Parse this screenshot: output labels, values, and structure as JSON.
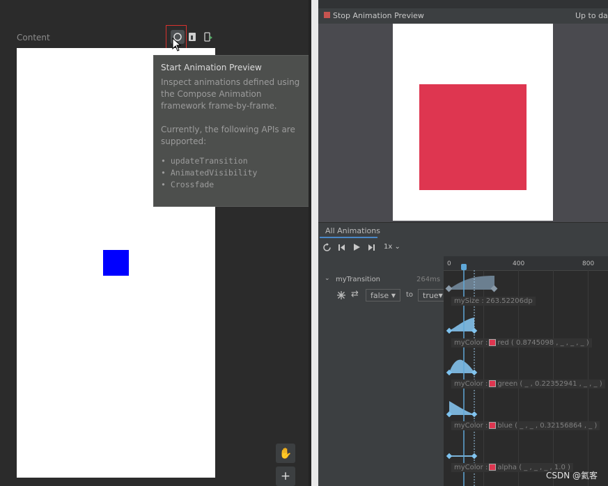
{
  "left_pane": {
    "content_label": "Content",
    "tooltip": {
      "title": "Start Animation Preview",
      "desc": "Inspect animations defined using the Compose Animation framework frame-by-frame.",
      "apis_intro": "Currently, the following APIs are supported:",
      "apis": [
        "updateTransition",
        "AnimatedVisibility",
        "Crossfade"
      ]
    },
    "side_buttons": [
      "✋",
      "+"
    ]
  },
  "right_pane": {
    "stop_label": "Stop Animation Preview",
    "up_to_date": "Up to dat",
    "tab_label": "All Animations",
    "speed_label": "1x",
    "transition_name": "myTransition",
    "duration": "264ms",
    "from_state": "false",
    "to_label": "to",
    "to_state": "true",
    "ticks": [
      "0",
      "400",
      "800"
    ],
    "rows": [
      {
        "label": "mySize : 263.52206dp"
      },
      {
        "label_prefix": "myColor :",
        "label_suffix": "red ( 0.8745098 , _ , _ , _ )"
      },
      {
        "label_prefix": "myColor :",
        "label_suffix": "green ( _ , 0.22352941 , _ , _ )"
      },
      {
        "label_prefix": "myColor :",
        "label_suffix": "blue ( _ , _ , 0.32156864 , _ )"
      },
      {
        "label_prefix": "myColor :",
        "label_suffix": "alpha ( _ , _ , _ , 1.0 )"
      }
    ]
  },
  "watermark": "CSDN @氦客",
  "colors": {
    "accent_red": "#de3650",
    "blue_square": "#0000ff",
    "highlight": "#d9322e",
    "timeline_blue": "#5fa8d8"
  }
}
